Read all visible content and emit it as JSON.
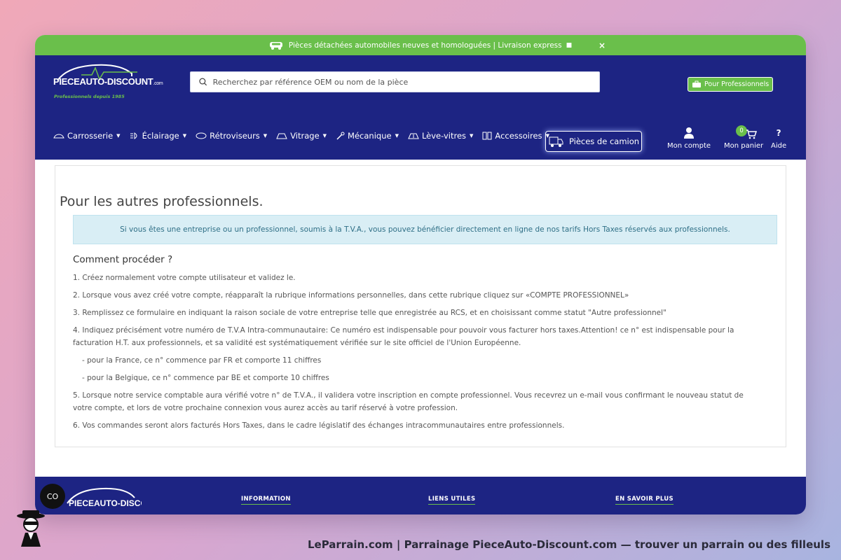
{
  "topbar": {
    "message": "Pièces détachées automobiles neuves et homologuées | Livraison express",
    "close": "×"
  },
  "logo": {
    "text": "PIECEAUTO-DISCOUNT",
    "suffix": ".com",
    "tagline": "Professionnels depuis 1985"
  },
  "search": {
    "placeholder": "Recherchez par référence OEM ou nom de la pièce"
  },
  "header": {
    "pro_button": "Pour Professionnels",
    "truck_button": "Pièces de camion",
    "account": "Mon compte",
    "cart": "Mon panier",
    "cart_count": "0",
    "help": "Aide",
    "help_icon": "?"
  },
  "nav": {
    "items": [
      {
        "label": "Carrosserie",
        "icon": "car-body-icon"
      },
      {
        "label": "Éclairage",
        "icon": "headlight-icon"
      },
      {
        "label": "Rétroviseurs",
        "icon": "mirror-icon"
      },
      {
        "label": "Vitrage",
        "icon": "windshield-icon"
      },
      {
        "label": "Mécanique",
        "icon": "wrench-icon"
      },
      {
        "label": "Lève-vitres",
        "icon": "window-lift-icon"
      },
      {
        "label": "Accessoires",
        "icon": "accessories-icon"
      }
    ]
  },
  "content": {
    "title": "Pour les autres professionnels.",
    "alert": "Si vous êtes une entreprise ou un professionnel, soumis à la T.V.A., vous pouvez bénéficier directement en ligne de nos tarifs Hors Taxes réservés aux professionnels.",
    "howto": "Comment procéder ?",
    "steps": [
      "1. Créez normalement votre compte utilisateur et validez le.",
      "2. Lorsque vous avez créé votre compte, réapparaît la rubrique informations personnelles, dans cette rubrique cliquez sur «COMPTE PROFESSIONNEL»",
      "3. Remplissez ce formulaire en indiquant la raison sociale de votre entreprise telle que enregistrée au RCS, et en choisissant comme statut \"Autre professionnel\"",
      "4. Indiquez précisément votre numéro de T.V.A Intra-communautaire: Ce numéro est indispensable pour pouvoir vous facturer hors taxes.Attention! ce n° est indispensable pour la facturation H.T. aux professionnels, et sa validité est systématiquement vérifiée sur le site officiel de l'Union Européenne.",
      "- pour la France, ce n° commence par FR et comporte 11 chiffres",
      "- pour la Belgique, ce n° commence par BE et comporte 10 chiffres",
      "5. Lorsque notre service comptable aura vérifié votre n° de T.V.A., il validera votre inscription en compte professionnel. Vous recevrez un e-mail vous confirmant le nouveau statut de votre compte, et lors de votre prochaine connexion vous aurez accès au tarif réservé à votre profession.",
      "6. Vos commandes seront alors facturés Hors Taxes, dans le cadre législatif des échanges intracommunautaires entre professionnels."
    ]
  },
  "footer": {
    "col1": "INFORMATION",
    "col2": "LIENS UTILES",
    "col3": "EN SAVOIR PLUS",
    "co_button": "CO",
    "logo_text": "PIECEAUTO-DISCOUNT"
  },
  "caption": "LeParrain.com | Parrainage PieceAuto-Discount.com — trouver un parrain ou des filleuls",
  "colors": {
    "green": "#6abf4b",
    "navy": "#1d2483"
  }
}
